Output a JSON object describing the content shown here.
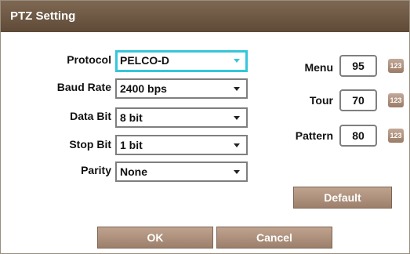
{
  "dialog": {
    "title": "PTZ Setting"
  },
  "form": {
    "protocol": {
      "label": "Protocol",
      "value": "PELCO-D"
    },
    "baud_rate": {
      "label": "Baud Rate",
      "value": "2400 bps"
    },
    "data_bit": {
      "label": "Data Bit",
      "value": "8 bit"
    },
    "stop_bit": {
      "label": "Stop Bit",
      "value": "1 bit"
    },
    "parity": {
      "label": "Parity",
      "value": "None"
    }
  },
  "presets": {
    "menu": {
      "label": "Menu",
      "value": "95"
    },
    "tour": {
      "label": "Tour",
      "value": "70"
    },
    "pattern": {
      "label": "Pattern",
      "value": "80"
    },
    "keypad_label": "123"
  },
  "buttons": {
    "default": "Default",
    "ok": "OK",
    "cancel": "Cancel"
  },
  "colors": {
    "titlebar": "#6b5542",
    "button": "#b0937f",
    "focus": "#35c6db"
  }
}
